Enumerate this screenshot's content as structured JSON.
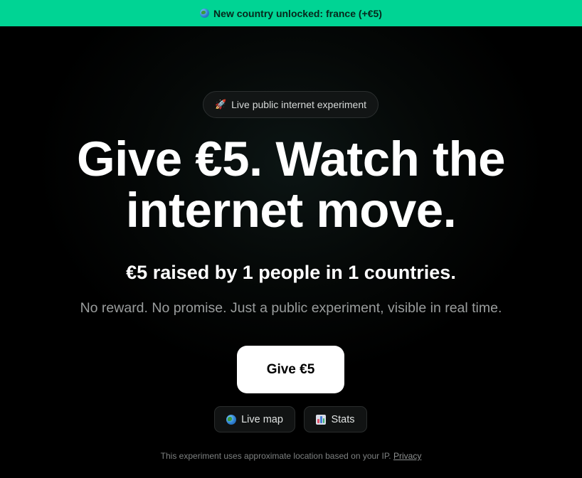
{
  "banner": {
    "icon": "globe-icon",
    "text": "New country unlocked: france (+€5)"
  },
  "pill": {
    "icon": "rocket-icon",
    "label": "Live public internet experiment"
  },
  "hero": {
    "headline_line1": "Give €5. Watch the",
    "headline_line2": "internet move.",
    "raised_text": "€5 raised by 1 people in 1 countries.",
    "subtitle": "No reward. No promise. Just a public experiment, visible in real time."
  },
  "actions": {
    "give_label": "Give €5",
    "live_map_label": "Live map",
    "live_map_icon": "globe-icon",
    "stats_label": "Stats",
    "stats_icon": "bar-chart-icon"
  },
  "footer": {
    "text": "This experiment uses approximate location based on your IP.",
    "link_label": "Privacy"
  },
  "colors": {
    "banner_bg": "#00d494",
    "page_bg": "#000000",
    "primary_button_bg": "#ffffff",
    "muted_text": "#9a9d9d"
  }
}
